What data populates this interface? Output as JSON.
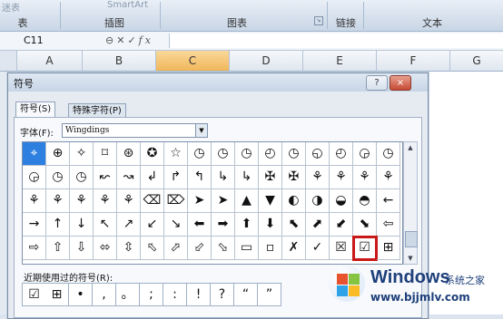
{
  "ribbon": {
    "groups": [
      "表",
      "插图",
      "图表",
      "链接",
      "文本"
    ],
    "smartart": "SmartArt",
    "table_stub": "迷表"
  },
  "formula_bar": {
    "name_box": "C11",
    "icons": [
      "cancel-icon",
      "check-icon",
      "fx-icon"
    ],
    "fx": "fx",
    "cancel": "✕",
    "confirm": "✓",
    "value": ""
  },
  "columns": [
    "A",
    "B",
    "C",
    "D",
    "E",
    "F",
    "G"
  ],
  "selected_column": "C",
  "dialog": {
    "title": "符号",
    "help": "?",
    "close": "×",
    "tabs": [
      "符号(S)",
      "特殊字符(P)"
    ],
    "font_label": "字体(F):",
    "font_value": "Wingdings",
    "symbols": [
      [
        "⌖",
        "⊕",
        "✧",
        "⌑",
        "⊛",
        "✪",
        "☆",
        "◷",
        "◷",
        "◷",
        "◴",
        "◷",
        "◵",
        "◴",
        "◶",
        "◷"
      ],
      [
        "◶",
        "◷",
        "◷",
        "↜",
        "↝",
        "↲",
        "↱",
        "↰",
        "↳",
        "↳",
        "✠",
        "✠",
        "⚘",
        "⚘",
        "⚘",
        "⚘"
      ],
      [
        "⚘",
        "⚘",
        "⚘",
        "⚘",
        "⚘",
        "⌫",
        "⌦",
        "➤",
        "➤",
        "▲",
        "▼",
        "◐",
        "◑",
        "◒",
        "◓",
        "←"
      ],
      [
        "→",
        "↑",
        "↓",
        "↖",
        "↗",
        "↙",
        "↘",
        "⬅",
        "➡",
        "⬆",
        "⬇",
        "⬉",
        "⬈",
        "⬋",
        "⬊",
        "⇦"
      ],
      [
        "⇨",
        "⇧",
        "⇩",
        "⬄",
        "⇳",
        "⬁",
        "⬀",
        "⬃",
        "⬂",
        "▭",
        "▫",
        "✗",
        "✓",
        "☒",
        "☑",
        "⊞"
      ]
    ],
    "recent_label": "近期使用过的符号(R):",
    "recent": [
      "☑",
      "⊞",
      "•",
      ",",
      "。",
      ";",
      ":",
      "!",
      "?",
      "“",
      "”"
    ]
  },
  "watermark": {
    "title": "Windows",
    "subtitle": "系统之家",
    "url": "www.bjjmlv.com"
  }
}
